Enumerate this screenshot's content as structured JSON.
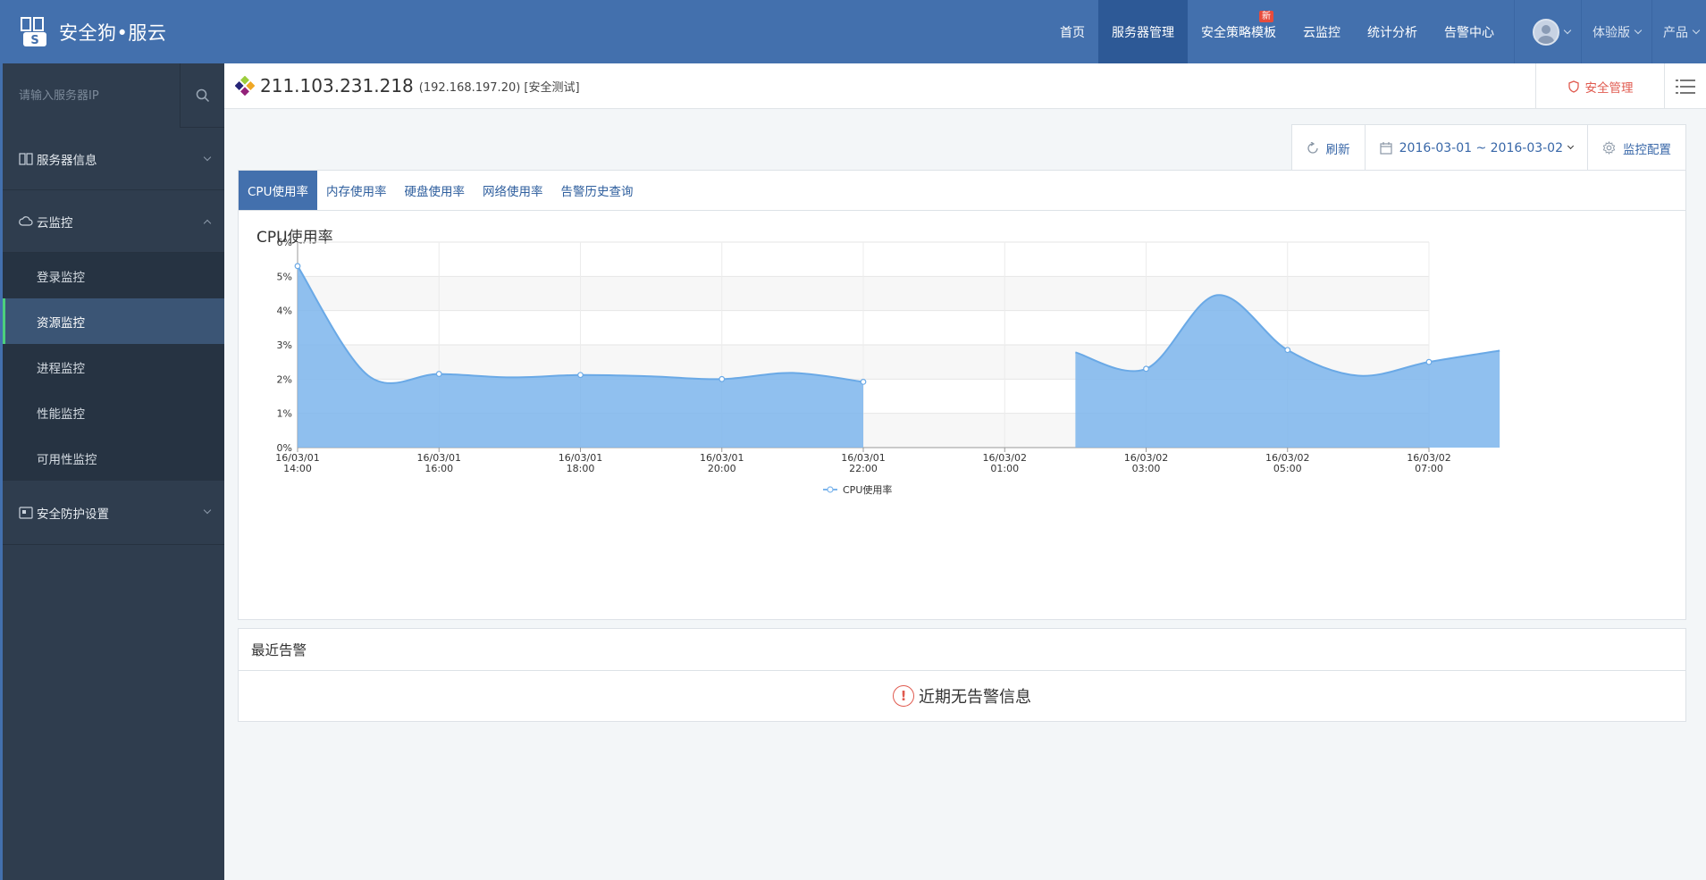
{
  "app": {
    "logo_text": "安全狗•服云"
  },
  "nav": {
    "items": [
      {
        "label": "首页",
        "active": false
      },
      {
        "label": "服务器管理",
        "active": true
      },
      {
        "label": "安全策略模板",
        "active": false,
        "badge": "新"
      },
      {
        "label": "云监控",
        "active": false
      },
      {
        "label": "统计分析",
        "active": false
      },
      {
        "label": "告警中心",
        "active": false
      }
    ],
    "trial_label": "体验版",
    "product_label": "产品"
  },
  "sidebar": {
    "search_placeholder": "请输入服务器IP",
    "groups": [
      {
        "label": "服务器信息",
        "icon": "columns-icon",
        "expanded": false
      },
      {
        "label": "云监控",
        "icon": "cloud-icon",
        "expanded": true,
        "items": [
          {
            "label": "登录监控",
            "active": false
          },
          {
            "label": "资源监控",
            "active": true
          },
          {
            "label": "进程监控",
            "active": false
          },
          {
            "label": "性能监控",
            "active": false
          },
          {
            "label": "可用性监控",
            "active": false
          }
        ]
      },
      {
        "label": "安全防护设置",
        "icon": "shield-settings-icon",
        "expanded": false
      }
    ]
  },
  "host": {
    "ip": "211.103.231.218",
    "detail": "(192.168.197.20) [安全测试]",
    "security_button": "安全管理"
  },
  "toolbar": {
    "refresh": "刷新",
    "date_range": "2016-03-01 ~ 2016-03-02",
    "monitor_config": "监控配置"
  },
  "tabs": [
    {
      "label": "CPU使用率",
      "active": true
    },
    {
      "label": "内存使用率",
      "active": false
    },
    {
      "label": "硬盘使用率",
      "active": false
    },
    {
      "label": "网络使用率",
      "active": false
    },
    {
      "label": "告警历史查询",
      "active": false
    }
  ],
  "chart_data": {
    "type": "area",
    "title": "CPU使用率",
    "series": [
      {
        "name": "CPU使用率",
        "color": "#7cb5ec",
        "segments": [
          [
            {
              "x": "16/03/01 14:00",
              "y": 5.3
            },
            {
              "x": "16/03/01 15:00",
              "y": 2.1
            },
            {
              "x": "16/03/01 16:00",
              "y": 2.15
            },
            {
              "x": "16/03/01 17:00",
              "y": 2.05
            },
            {
              "x": "16/03/01 18:00",
              "y": 2.12
            },
            {
              "x": "16/03/01 19:00",
              "y": 2.08
            },
            {
              "x": "16/03/01 20:00",
              "y": 2.0
            },
            {
              "x": "16/03/01 21:00",
              "y": 2.18
            },
            {
              "x": "16/03/01 22:00",
              "y": 1.92
            }
          ],
          [
            {
              "x": "16/03/02 01:00",
              "y": 2.78
            },
            {
              "x": "16/03/02 02:00",
              "y": 2.3
            },
            {
              "x": "16/03/02 03:00",
              "y": 4.45
            },
            {
              "x": "16/03/02 04:00",
              "y": 2.85
            },
            {
              "x": "16/03/02 05:00",
              "y": 2.1
            },
            {
              "x": "16/03/02 06:00",
              "y": 2.5
            },
            {
              "x": "16/03/02 07:00",
              "y": 2.83
            }
          ]
        ]
      }
    ],
    "x_ticks": [
      [
        "16/03/01",
        "14:00"
      ],
      [
        "16/03/01",
        "16:00"
      ],
      [
        "16/03/01",
        "18:00"
      ],
      [
        "16/03/01",
        "20:00"
      ],
      [
        "16/03/01",
        "22:00"
      ],
      [
        "16/03/02",
        "01:00"
      ],
      [
        "16/03/02",
        "03:00"
      ],
      [
        "16/03/02",
        "05:00"
      ],
      [
        "16/03/02",
        "07:00"
      ]
    ],
    "marker_hours": [
      0,
      2,
      4,
      6,
      8,
      10,
      12,
      14,
      16
    ],
    "y_ticks": [
      "0%",
      "1%",
      "2%",
      "3%",
      "4%",
      "5%",
      "6%"
    ],
    "ylim": [
      0,
      6
    ],
    "legend": "CPU使用率",
    "legend_position": "bottom-center",
    "grid": true
  },
  "alerts": {
    "title": "最近告警",
    "empty_message": "近期无告警信息"
  }
}
